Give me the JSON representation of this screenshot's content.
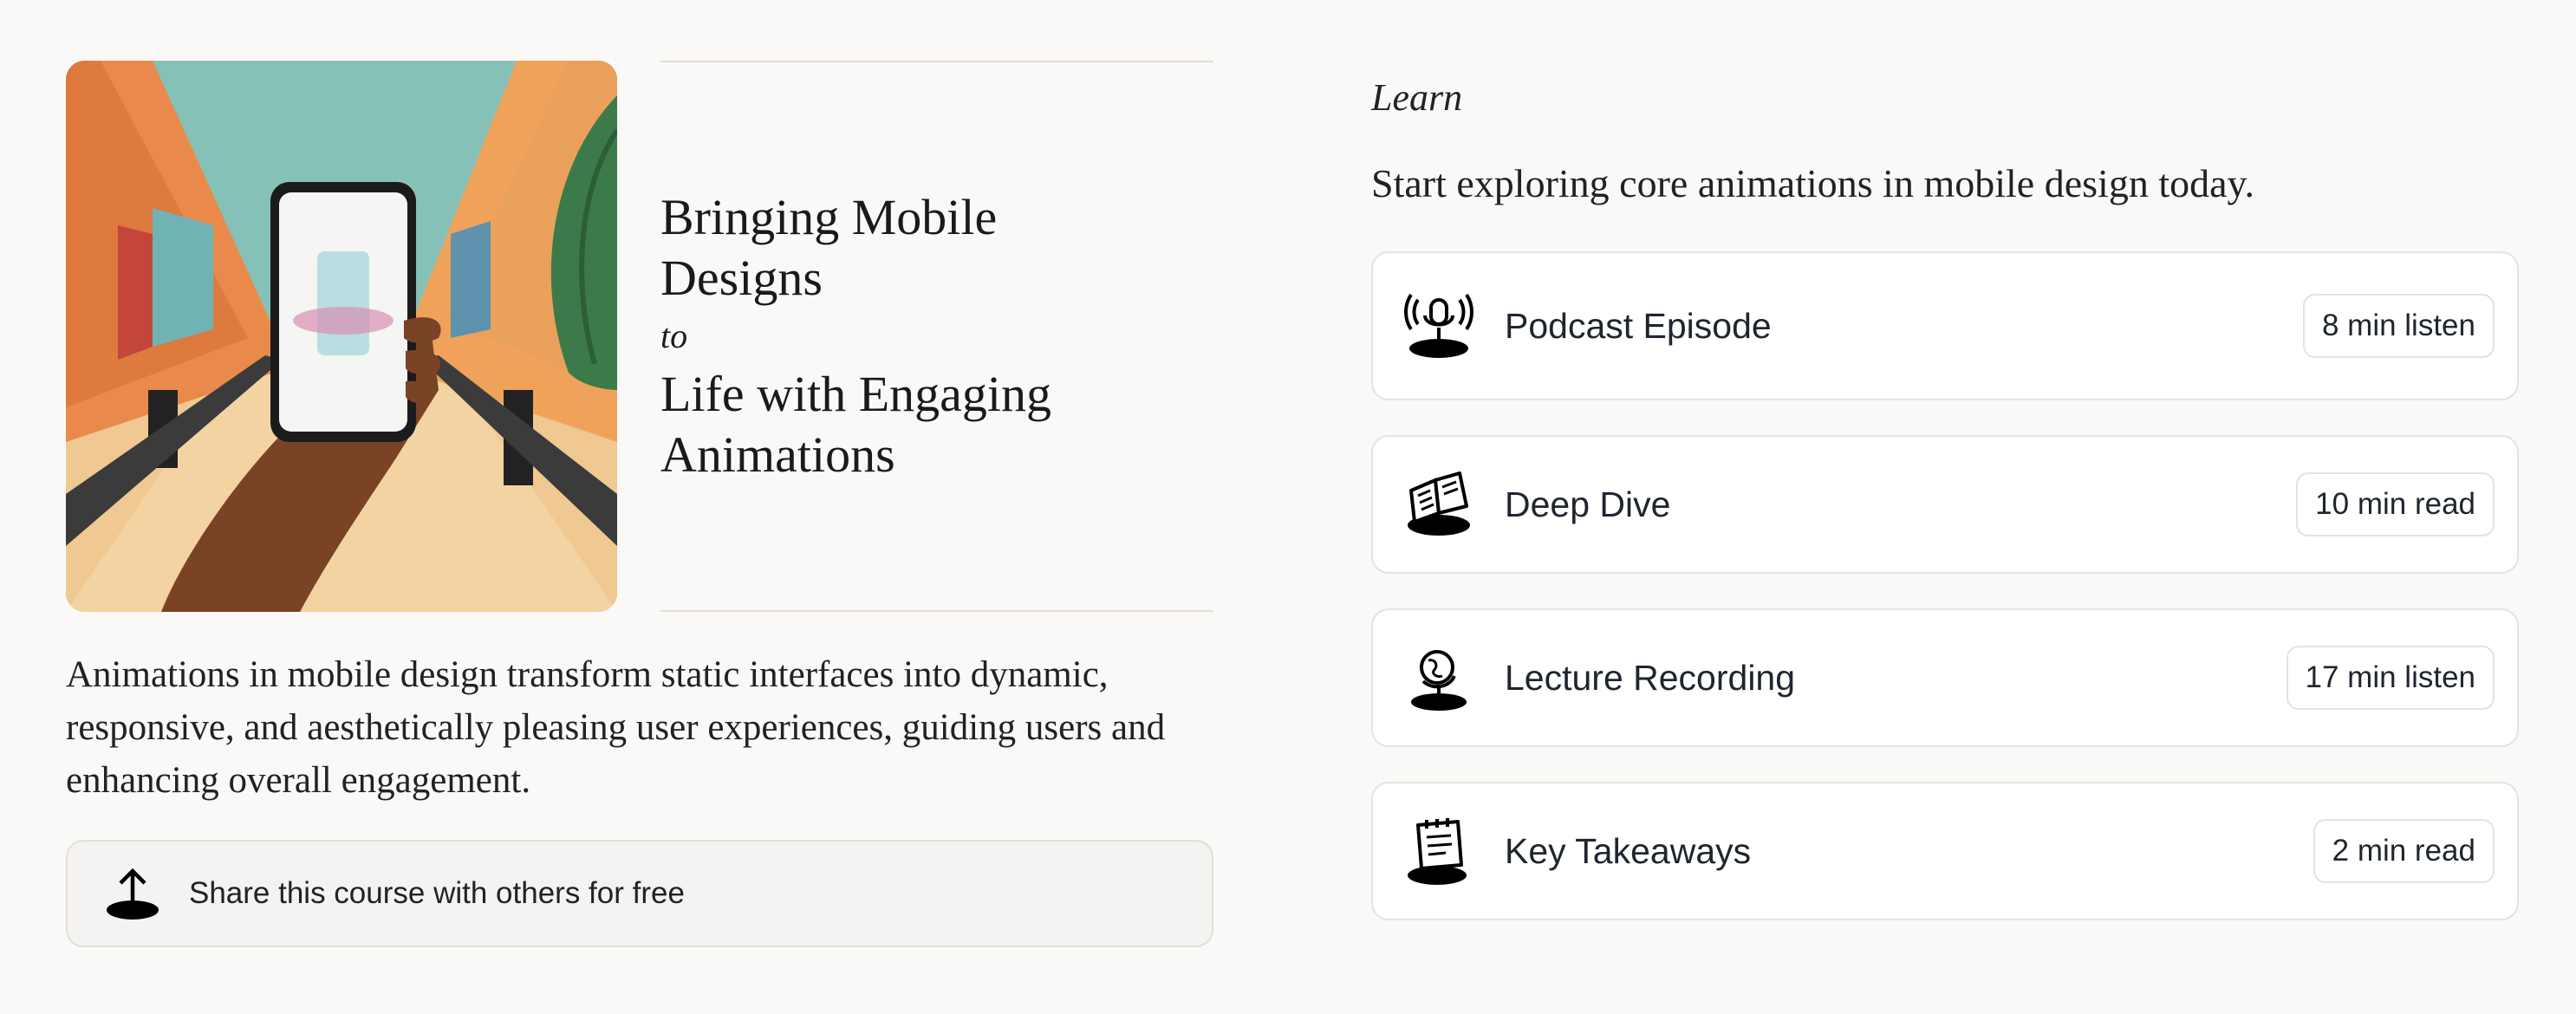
{
  "course": {
    "title_line1": "Bringing Mobile",
    "title_line2": "Designs",
    "title_connector": "to",
    "title_line3": "Life with Engaging",
    "title_line4": "Animations",
    "description": "Animations in mobile design transform static interfaces into dynamic, responsive, and aesthetically pleasing user experiences, guiding users and enhancing overall engagement.",
    "share_label": "Share this course with others for free",
    "share_icon": "share-upload-icon"
  },
  "learn": {
    "kicker": "Learn",
    "intro": "Start exploring core animations in mobile design today.",
    "items": [
      {
        "label": "Podcast Episode",
        "duration": "8 min listen",
        "icon": "podcast-microphone-icon"
      },
      {
        "label": "Deep Dive",
        "duration": "10 min read",
        "icon": "open-book-icon"
      },
      {
        "label": "Lecture Recording",
        "duration": "17 min listen",
        "icon": "globe-lecture-icon"
      },
      {
        "label": "Key Takeaways",
        "duration": "2 min read",
        "icon": "notepad-icon"
      }
    ]
  },
  "colors": {
    "background": "#faf9f7",
    "card_border": "#e5e3df",
    "text": "#1f2530"
  }
}
